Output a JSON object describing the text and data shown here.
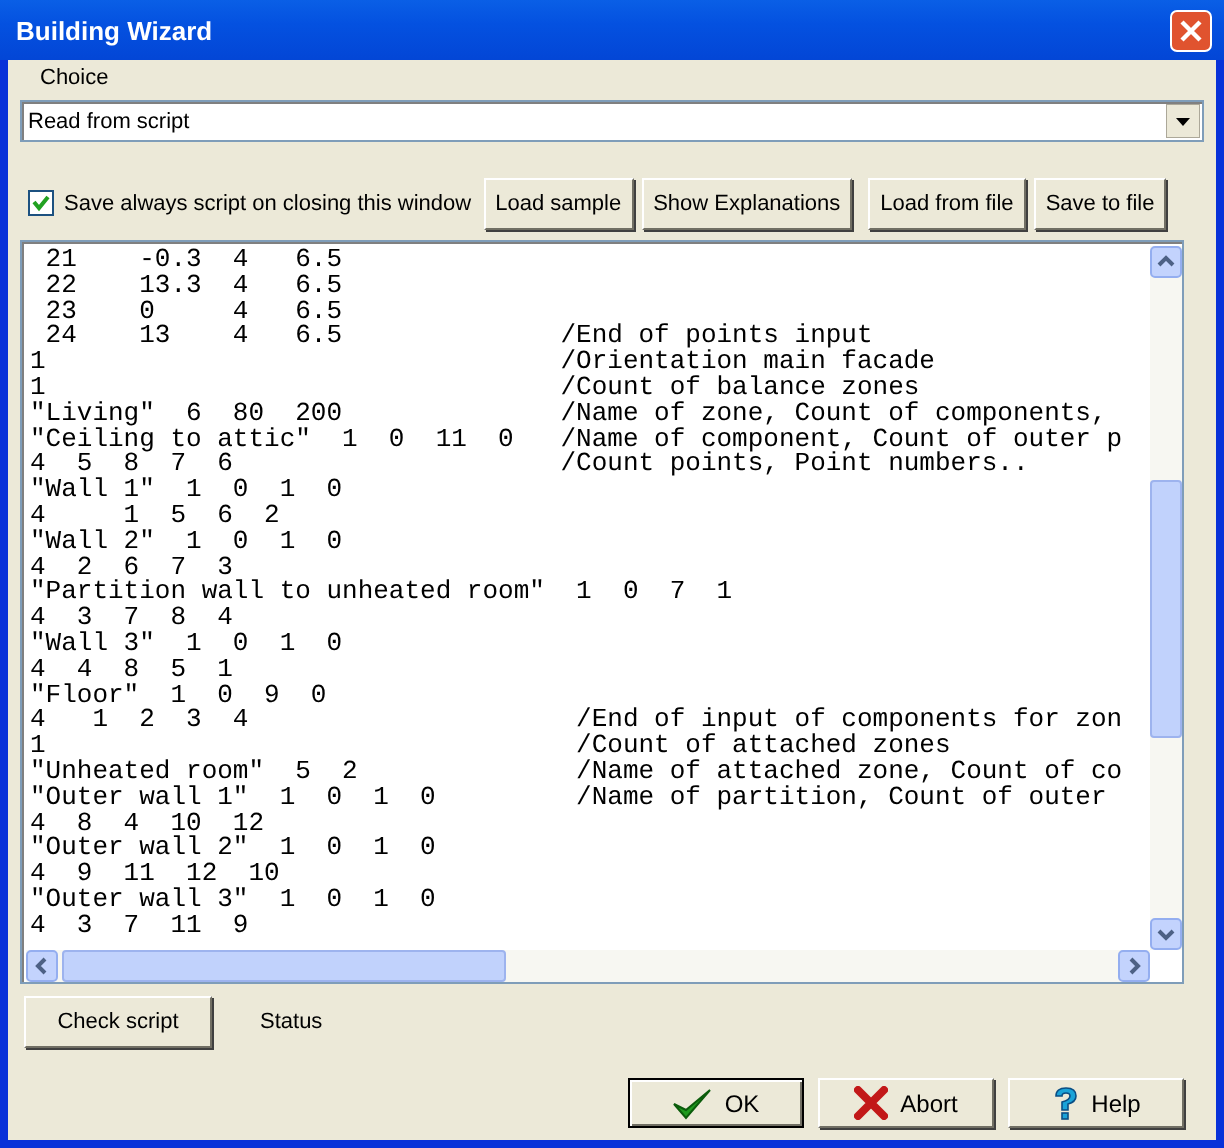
{
  "window": {
    "title": "Building Wizard"
  },
  "choice": {
    "label": "Choice",
    "value": "Read from script"
  },
  "save_always": {
    "label": "Save always script on closing this window",
    "checked": true
  },
  "toolbar_buttons": [
    "Load sample",
    "Show Explanations",
    "Load from file",
    "Save to file"
  ],
  "script_lines": [
    " 21    -0.3  4   6.5",
    " 22    13.3  4   6.5",
    " 23    0     4   6.5",
    " 24    13    4   6.5              /End of points input",
    "1                                 /Orientation main facade",
    "1                                 /Count of balance zones",
    "\"Living\"  6  80  200              /Name of zone, Count of components,",
    "\"Ceiling to attic\"  1  0  11  0   /Name of component, Count of outer p",
    "4  5  8  7  6                     /Count points, Point numbers..",
    "\"Wall 1\"  1  0  1  0",
    "4     1  5  6  2",
    "\"Wall 2\"  1  0  1  0",
    "4  2  6  7  3",
    "\"Partition wall to unheated room\"  1  0  7  1",
    "4  3  7  8  4",
    "\"Wall 3\"  1  0  1  0",
    "4  4  8  5  1",
    "\"Floor\"  1  0  9  0",
    "4   1  2  3  4                     /End of input of components for zon",
    "1                                  /Count of attached zones",
    "\"Unheated room\"  5  2              /Name of attached zone, Count of co",
    "\"Outer wall 1\"  1  0  1  0         /Name of partition, Count of outer",
    "4  8  4  10  12",
    "\"Outer wall 2\"  1  0  1  0",
    "4  9  11  12  10",
    "\"Outer wall 3\"  1  0  1  0",
    "4  3  7  11  9"
  ],
  "check_button": "Check script",
  "status": "Status",
  "dialog_buttons": [
    {
      "label": "OK",
      "kind": "ok",
      "default": true
    },
    {
      "label": "Abort",
      "kind": "abort",
      "default": false
    },
    {
      "label": "Help",
      "kind": "help",
      "default": false
    }
  ]
}
